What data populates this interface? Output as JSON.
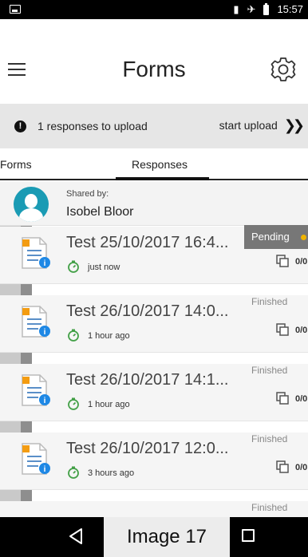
{
  "status_bar": {
    "time": "15:57",
    "icons": [
      "gallery-icon",
      "vibrate-icon",
      "airplane-icon",
      "battery-icon"
    ]
  },
  "app_bar": {
    "title": "Forms",
    "menu_icon": "hamburger-menu-icon",
    "settings_icon": "gear-icon"
  },
  "upload_banner": {
    "message": "1 responses to upload",
    "action_label": "start upload",
    "action_icon": "double-chevron-right-icon"
  },
  "tabs": [
    {
      "label": "Forms",
      "selected": false
    },
    {
      "label": "Responses",
      "selected": true
    }
  ],
  "shared": {
    "label": "Shared by:",
    "name": "Isobel Bloor"
  },
  "responses": [
    {
      "title": "Test 25/10/2017 16:4...",
      "time": "just now",
      "status": "Pending",
      "count": "0/0"
    },
    {
      "title": "Test 26/10/2017 14:0...",
      "time": "1 hour ago",
      "status": "Finished",
      "count": "0/0"
    },
    {
      "title": "Test 26/10/2017 14:1...",
      "time": "1 hour ago",
      "status": "Finished",
      "count": "0/0"
    },
    {
      "title": "Test 26/10/2017 12:0...",
      "time": "3 hours ago",
      "status": "Finished",
      "count": "0/0"
    },
    {
      "title": "",
      "time": "",
      "status": "Finished",
      "count": ""
    }
  ],
  "nav_bar": {
    "overlay_label": "Image 17",
    "icons": [
      "back-triangle-icon",
      "recent-apps-square-icon"
    ]
  },
  "colors": {
    "status_bar": "#000000",
    "banner_bg": "#e6e6e6",
    "row_bg": "#f5f5f5",
    "pending_badge": "#777777",
    "pending_dot": "#f0b400",
    "avatar": "#1a9bb4",
    "doc_icon_blue": "#1e88e5",
    "doc_icon_orange": "#f39c12",
    "time_icon_green": "#43a047"
  }
}
